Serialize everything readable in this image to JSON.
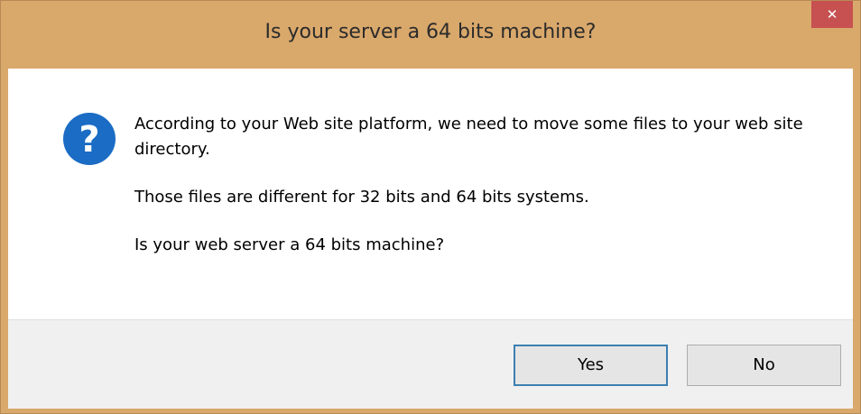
{
  "window": {
    "title": "Is your server a 64 bits machine?",
    "close_glyph": "✕"
  },
  "icon": {
    "name": "question-icon",
    "glyph": "?",
    "color": "#1a6cc4"
  },
  "message": {
    "line1": "According to your Web site platform, we need to move some files to your web site directory.",
    "line2": "Those files are different for 32 bits and 64 bits systems.",
    "line3": "Is your web server a 64 bits machine?"
  },
  "buttons": {
    "yes_label": "Yes",
    "no_label": "No"
  },
  "colors": {
    "titlebar": "#d9a86b",
    "close_button": "#c75050",
    "default_button_border": "#3c7fb1"
  }
}
